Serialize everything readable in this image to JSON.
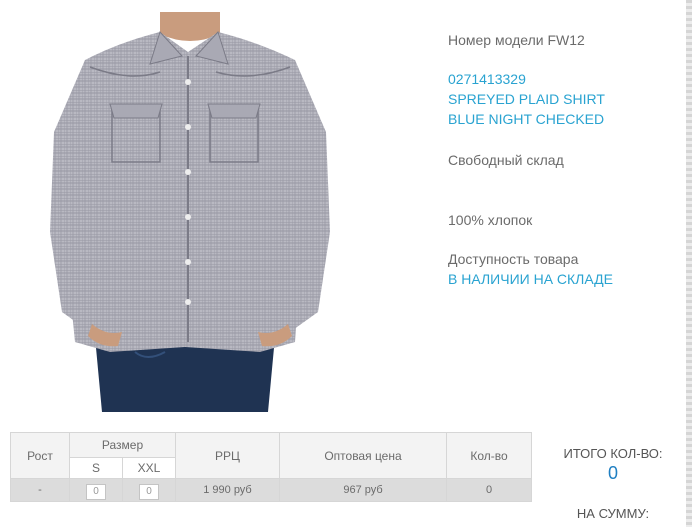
{
  "product": {
    "model_label": "Номер модели FW12",
    "sku": "0271413329",
    "name_line1": "SPREYED PLAID SHIRT",
    "name_line2": "BLUE NIGHT CHECKED",
    "stock_type": "Свободный склад",
    "material": "100% хлопок",
    "availability_label": "Доступность товара",
    "availability_value": "В НАЛИЧИИ НА СКЛАДЕ",
    "image_alt": "shirt-product-photo"
  },
  "order_table": {
    "col_height": "Рост",
    "col_size": "Размер",
    "col_rrp": "РРЦ",
    "col_wholesale": "Оптовая цена",
    "col_qty": "Кол-во",
    "sizes": [
      "S",
      "XXL"
    ],
    "row": {
      "height": "-",
      "qty_s": "0",
      "qty_xxl": "0",
      "rrp": "1 990 руб",
      "wholesale": "967 руб",
      "qty": "0"
    }
  },
  "totals": {
    "qty_label": "ИТОГО КОЛ-ВО:",
    "qty_value": "0",
    "sum_label": "НА СУММУ:"
  },
  "colors": {
    "accent_blue": "#29a3d1",
    "total_blue": "#1f7fc2",
    "text_gray": "#6b6b6b"
  }
}
